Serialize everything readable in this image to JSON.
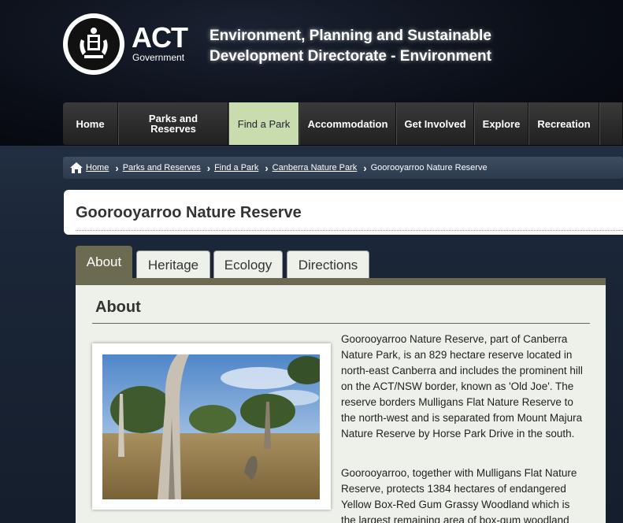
{
  "header": {
    "logo_text": "ACT",
    "logo_subtext": "Government",
    "directorate_line1": "Environment, Planning and Sustainable",
    "directorate_line2": "Development Directorate - Environment"
  },
  "nav": {
    "items": [
      {
        "label": "Home",
        "active": false
      },
      {
        "label": "Parks and Reserves",
        "active": false
      },
      {
        "label": "Find a Park",
        "active": true
      },
      {
        "label": "Accommodation",
        "active": false
      },
      {
        "label": "Get Involved",
        "active": false
      },
      {
        "label": "Explore",
        "active": false
      },
      {
        "label": "Recreation",
        "active": false
      }
    ]
  },
  "breadcrumb": {
    "items": [
      "Home",
      "Parks and Reserves",
      "Find a Park",
      "Canberra Nature Park"
    ],
    "current": "Goorooyarroo Nature Reserve"
  },
  "page": {
    "title": "Goorooyarroo Nature Reserve"
  },
  "tabs": [
    {
      "label": "About",
      "active": true
    },
    {
      "label": "Heritage",
      "active": false
    },
    {
      "label": "Ecology",
      "active": false
    },
    {
      "label": "Directions",
      "active": false
    }
  ],
  "content": {
    "heading": "About",
    "para1": "Goorooyarroo Nature Reserve, part of Canberra Nature Park, is an 829 hectare reserve located in north-east Canberra and includes the prominent hill on the ACT/NSW border, known as 'Old Joe'. The reserve borders Mulligans Flat Nature Reserve to the north-west and is separated from Mount Majura Nature Reserve by Horse Park Drive in the south.",
    "para2": "Goorooyarroo, together with Mulligans Flat Nature Reserve, protects 1384 hectares of endangered Yellow Box-Red Gum Grassy Woodland which is the largest remaining area of box-gum woodland"
  },
  "colors": {
    "nav_active": "#c9dcae",
    "tab_active": "#6d6a52",
    "content_bg": "#eef1ea"
  }
}
